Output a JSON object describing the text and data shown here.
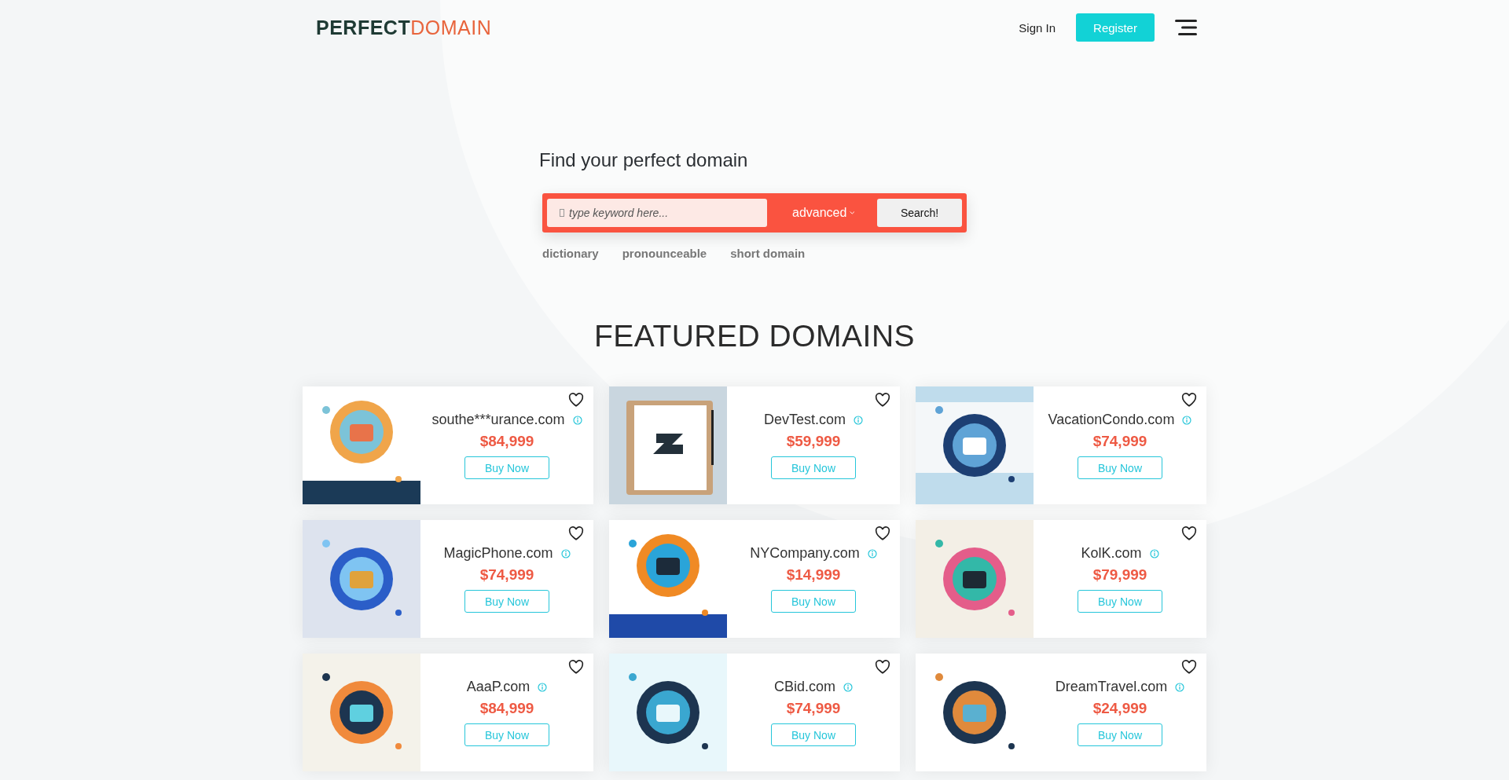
{
  "header": {
    "logo": {
      "part_1": "PERFECT",
      "part_2": "DOMAIN"
    },
    "sign_in": "Sign In",
    "register": "Register"
  },
  "hero": {
    "title": "Find your perfect domain",
    "search": {
      "placeholder": "type keyword here...",
      "advanced": "advanced",
      "button": "Search!"
    },
    "tags": [
      "dictionary",
      "pronounceable",
      "short domain"
    ]
  },
  "featured": {
    "title": "FEATURED DOMAINS",
    "domains": [
      {
        "name": "southe***urance.com",
        "price": "$84,999",
        "button": "Buy Now"
      },
      {
        "name": "DevTest.com",
        "price": "$59,999",
        "button": "Buy Now"
      },
      {
        "name": "VacationCondo.com",
        "price": "$74,999",
        "button": "Buy Now"
      },
      {
        "name": "MagicPhone.com",
        "price": "$74,999",
        "button": "Buy Now"
      },
      {
        "name": "NYCompany.com",
        "price": "$14,999",
        "button": "Buy Now"
      },
      {
        "name": "KolK.com",
        "price": "$79,999",
        "button": "Buy Now"
      },
      {
        "name": "AaaP.com",
        "price": "$84,999",
        "button": "Buy Now"
      },
      {
        "name": "CBid.com",
        "price": "$74,999",
        "button": "Buy Now"
      },
      {
        "name": "DreamTravel.com",
        "price": "$24,999",
        "button": "Buy Now"
      }
    ]
  }
}
